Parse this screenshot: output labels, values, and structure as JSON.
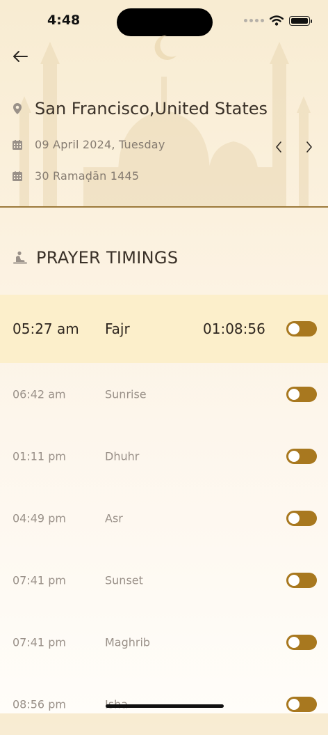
{
  "status_bar": {
    "time": "4:48"
  },
  "header": {
    "location": "San Francisco,United States",
    "gregorian_date": "09 April 2024, Tuesday",
    "hijri_date": "30 Ramaḍān 1445"
  },
  "section": {
    "title": "PRAYER TIMINGS"
  },
  "prayers": [
    {
      "time": "05:27 am",
      "name": "Fajr",
      "countdown": "01:08:56",
      "active": true
    },
    {
      "time": "06:42 am",
      "name": "Sunrise"
    },
    {
      "time": "01:11 pm",
      "name": "Dhuhr"
    },
    {
      "time": "04:49 pm",
      "name": "Asr"
    },
    {
      "time": "07:41 pm",
      "name": "Sunset"
    },
    {
      "time": "07:41 pm",
      "name": "Maghrib"
    },
    {
      "time": "08:56 pm",
      "name": "Isha"
    }
  ],
  "colors": {
    "accent": "#a8781f",
    "highlight": "#fcefcb",
    "divider": "#9c7a3a"
  },
  "icons": [
    "back-arrow-icon",
    "location-pin-icon",
    "calendar-icon",
    "chevron-left-icon",
    "chevron-right-icon",
    "prayer-icon"
  ]
}
